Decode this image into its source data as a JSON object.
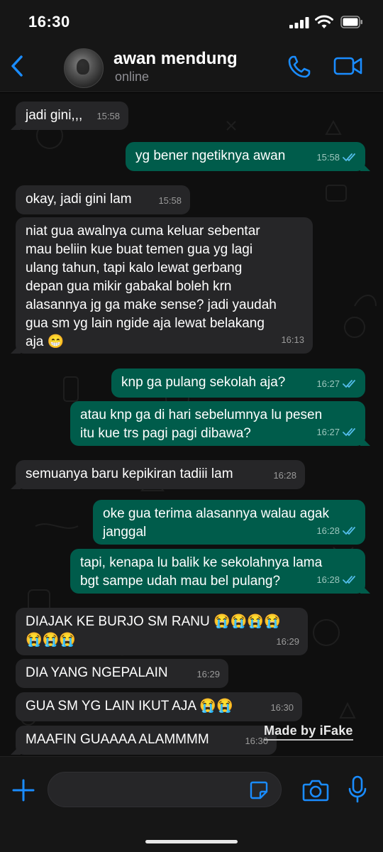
{
  "status_bar": {
    "time": "16:30"
  },
  "header": {
    "contact_name": "awan mendung",
    "contact_status": "online"
  },
  "messages": [
    {
      "dir": "in",
      "text": "jadi gini,,,",
      "time": "15:58"
    },
    {
      "dir": "out",
      "text": "yg bener ngetiknya awan",
      "time": "15:58",
      "read": true
    },
    {
      "dir": "in",
      "text": "okay, jadi gini lam",
      "time": "15:58"
    },
    {
      "dir": "in",
      "text": "niat gua awalnya cuma keluar sebentar\nmau beliin kue buat temen gua yg lagi\nulang tahun, tapi kalo lewat gerbang\ndepan gua mikir gabakal boleh krn\nalasannya jg ga make sense? jadi yaudah\ngua sm yg lain ngide aja lewat belakang\naja 😁",
      "time": "16:13"
    },
    {
      "dir": "out",
      "text": "knp ga pulang sekolah aja?",
      "time": "16:27",
      "read": true
    },
    {
      "dir": "out",
      "text": "atau knp ga di hari sebelumnya lu pesen\nitu kue trs pagi pagi dibawa?",
      "time": "16:27",
      "read": true
    },
    {
      "dir": "in",
      "text": "semuanya baru kepikiran tadiii lam",
      "time": "16:28"
    },
    {
      "dir": "out",
      "text": "oke gua terima alasannya walau agak\njanggal",
      "time": "16:28",
      "read": true
    },
    {
      "dir": "out",
      "text": "tapi, kenapa lu balik ke sekolahnya lama\nbgt sampe udah mau bel pulang?",
      "time": "16:28",
      "read": true
    },
    {
      "dir": "in",
      "text": "DIAJAK KE BURJO SM RANU 😭😭😭😭\n😭😭😭",
      "time": "16:29"
    },
    {
      "dir": "in",
      "text": "DIA YANG NGEPALAIN",
      "time": "16:29"
    },
    {
      "dir": "in",
      "text": "GUA SM YG LAIN IKUT AJA 😭😭",
      "time": "16:30"
    },
    {
      "dir": "in",
      "text": "MAAFIN GUAAAA ALAMMMM",
      "time": "16:30"
    }
  ],
  "watermark": "Made by iFake",
  "icons": [
    "back-chevron-icon",
    "phone-icon",
    "video-camera-icon",
    "plus-icon",
    "sticker-icon",
    "camera-icon",
    "microphone-icon"
  ],
  "colors": {
    "accent": "#1a8cff",
    "outgoing_bubble": "#005c4b",
    "incoming_bubble": "#262628",
    "read_ticks": "#53bdeb"
  }
}
